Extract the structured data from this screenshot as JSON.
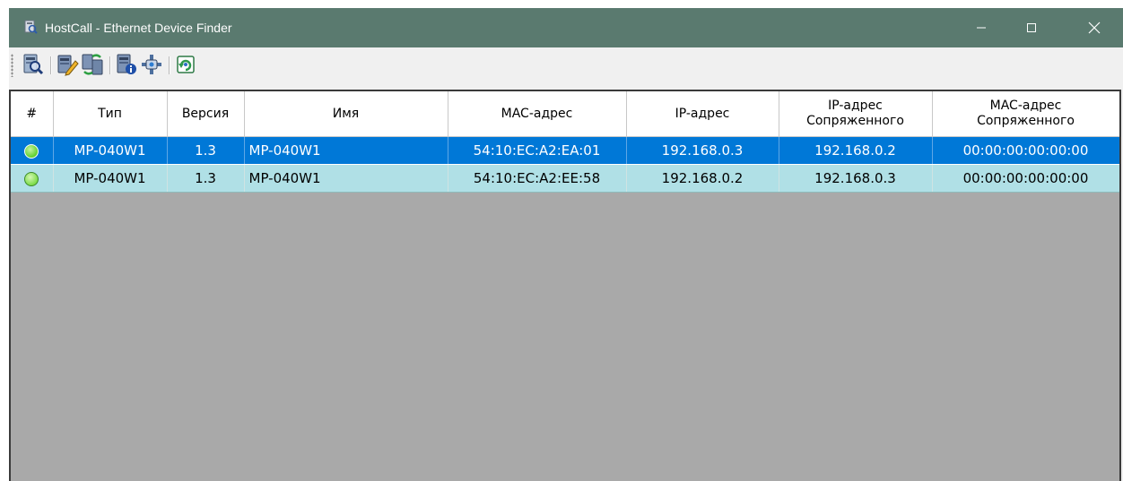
{
  "window": {
    "title": "HostCall - Ethernet Device Finder",
    "title_bar_color": "#5a7a6f"
  },
  "toolbar": {
    "buttons": [
      {
        "name": "search-devices-button",
        "icon": "server-magnifier-icon"
      },
      {
        "name": "edit-device-button",
        "icon": "server-pencil-icon"
      },
      {
        "name": "pair-devices-button",
        "icon": "servers-sync-icon"
      },
      {
        "name": "device-info-button",
        "icon": "server-info-icon"
      },
      {
        "name": "network-connect-button",
        "icon": "network-plug-icon"
      },
      {
        "name": "firmware-update-button",
        "icon": "refresh-globe-icon"
      }
    ]
  },
  "table": {
    "headers": [
      "#",
      "Тип",
      "Версия",
      "Имя",
      "MAC-адрес",
      "IP-адрес",
      "IP-адрес\nСопряженного",
      "MAC-адрес\nСопряженного"
    ],
    "rows": [
      {
        "status": "online",
        "type": "MP-040W1",
        "version": "1.3",
        "name": "MP-040W1",
        "mac": "54:10:EC:A2:EA:01",
        "ip": "192.168.0.3",
        "paired_ip": "192.168.0.2",
        "paired_mac": "00:00:00:00:00:00",
        "selected": true
      },
      {
        "status": "online",
        "type": "MP-040W1",
        "version": "1.3",
        "name": "MP-040W1",
        "mac": "54:10:EC:A2:EE:58",
        "ip": "192.168.0.2",
        "paired_ip": "192.168.0.3",
        "paired_mac": "00:00:00:00:00:00",
        "selected": false
      }
    ]
  },
  "colors": {
    "selected_row": "#0078d7",
    "normal_row": "#b0e0e6",
    "empty_area": "#a9a9a9",
    "status_online": "#7ddc4a"
  }
}
